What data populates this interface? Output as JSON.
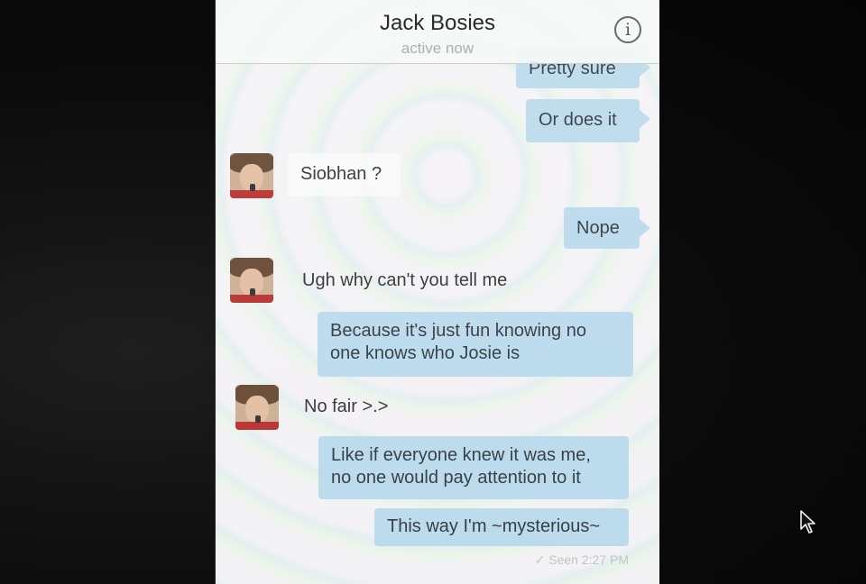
{
  "header": {
    "contact_name": "Jack Bosies",
    "status": "active now",
    "info_icon": "info-icon",
    "info_glyph": "i"
  },
  "messages": [
    {
      "direction": "outgoing",
      "text": "Pretty sure"
    },
    {
      "direction": "outgoing",
      "text": "Or does it"
    },
    {
      "direction": "incoming",
      "text": "Siobhan ?"
    },
    {
      "direction": "outgoing",
      "text": "Nope"
    },
    {
      "direction": "incoming",
      "text": "Ugh why can't you tell me"
    },
    {
      "direction": "outgoing",
      "lines": [
        "Because it's just fun knowing no",
        "one knows who Josie is"
      ]
    },
    {
      "direction": "incoming",
      "text": "No fair >.>"
    },
    {
      "direction": "outgoing",
      "lines": [
        "Like if everyone knew it was me,",
        "no one would pay attention to it"
      ]
    },
    {
      "direction": "outgoing",
      "text": "This way I'm ~mysterious~"
    }
  ],
  "read_receipt": {
    "check": "✓",
    "text": "Seen 2:27 PM"
  },
  "colors": {
    "outgoing_bubble": "#b6d8ec",
    "incoming_bubble": "#fafafa",
    "page_background": "#0d0d0d"
  },
  "icons": [
    "info-icon",
    "avatar",
    "mouse-pointer-icon",
    "checkmark-icon"
  ]
}
